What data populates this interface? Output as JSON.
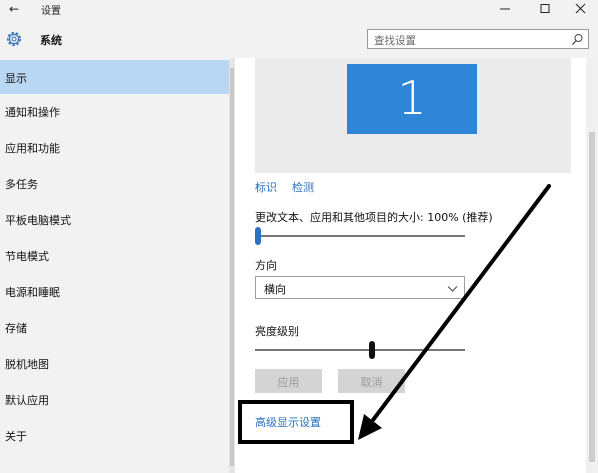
{
  "window": {
    "title": "设置",
    "back_icon": "back-arrow-icon",
    "controls": [
      "minimize-icon",
      "maximize-icon",
      "close-icon"
    ]
  },
  "header": {
    "section_title": "系统",
    "section_icon": "gear-icon",
    "search_placeholder": "查找设置",
    "search_icon": "search-icon"
  },
  "sidebar": {
    "active_index": 0,
    "items": [
      {
        "label": "显示"
      },
      {
        "label": "通知和操作"
      },
      {
        "label": "应用和功能"
      },
      {
        "label": "多任务"
      },
      {
        "label": "平板电脑模式"
      },
      {
        "label": "节电模式"
      },
      {
        "label": "电源和睡眠"
      },
      {
        "label": "存储"
      },
      {
        "label": "脱机地图"
      },
      {
        "label": "默认应用"
      },
      {
        "label": "关于"
      }
    ]
  },
  "display": {
    "monitor_number": "1",
    "identify_link": "标识",
    "detect_link": "检测",
    "scale_label": "更改文本、应用和其他项目的大小: 100% (推荐)",
    "scale_slider_level": 0,
    "orientation_label": "方向",
    "orientation_value": "横向",
    "brightness_label": "亮度级别",
    "brightness_slider_level": 0.56,
    "apply_button": "应用",
    "cancel_button": "取消",
    "advanced_link": "高级显示设置"
  },
  "colors": {
    "sidebar_bg": "#f2f2f2",
    "active_item": "#b9d6f2",
    "monitor_tile": "#2f86d8",
    "link": "#2a72bf"
  }
}
